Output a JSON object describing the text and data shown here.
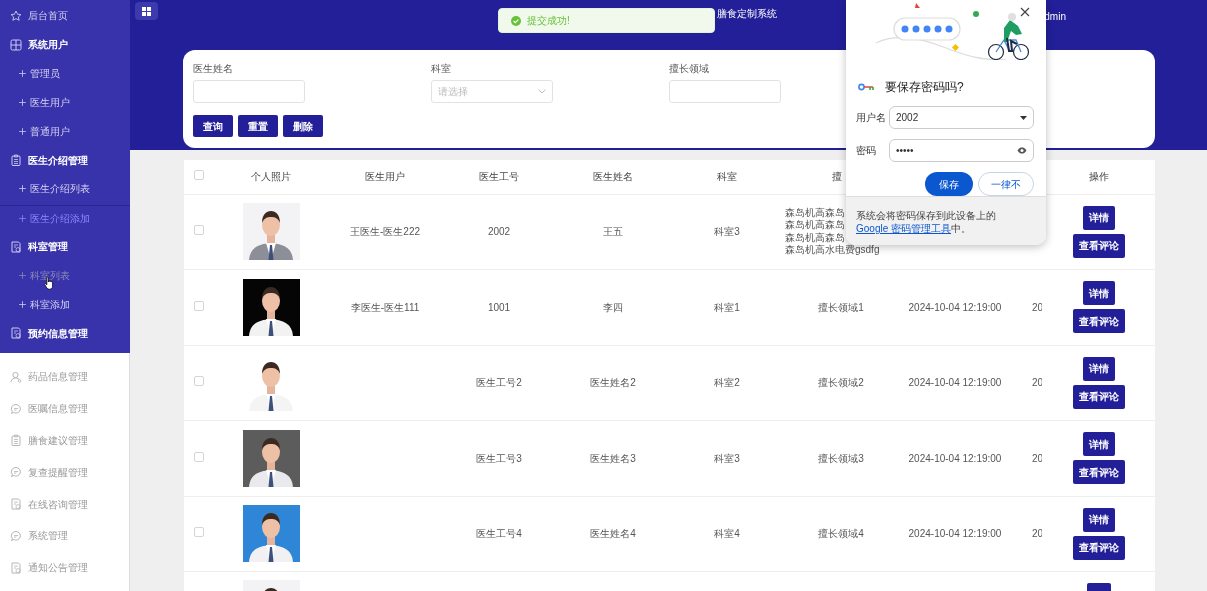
{
  "sidebar": {
    "sections": [
      {
        "items": [
          {
            "label": "后台首页",
            "kind": "link"
          },
          {
            "label": "系统用户",
            "kind": "group",
            "expanded": true,
            "children": [
              {
                "label": "管理员",
                "selected": false,
                "hovered": false
              },
              {
                "label": "医生用户",
                "selected": false,
                "hovered": false
              },
              {
                "label": "普通用户",
                "selected": false,
                "hovered": false
              }
            ]
          },
          {
            "label": "医生介绍管理",
            "kind": "group",
            "expanded": true,
            "children": [
              {
                "label": "医生介绍列表",
                "selected": false,
                "hovered": false
              },
              {
                "label": "医生介绍添加",
                "selected": true,
                "hovered": false
              }
            ]
          },
          {
            "label": "科室管理",
            "kind": "group",
            "expanded": true,
            "children": [
              {
                "label": "科室列表",
                "selected": false,
                "hovered": true
              },
              {
                "label": "科室添加",
                "selected": false,
                "hovered": false
              }
            ]
          },
          {
            "label": "预约信息管理",
            "kind": "group"
          }
        ]
      },
      {
        "items": [
          {
            "label": "药品信息管理",
            "kind": "group"
          },
          {
            "label": "医嘱信息管理",
            "kind": "group"
          },
          {
            "label": "膳食建议管理",
            "kind": "group"
          },
          {
            "label": "复查提醒管理",
            "kind": "group"
          },
          {
            "label": "在线咨询管理",
            "kind": "group"
          },
          {
            "label": "系统管理",
            "kind": "group"
          },
          {
            "label": "通知公告管理",
            "kind": "group"
          }
        ]
      }
    ]
  },
  "header": {
    "title": "膳食定制系统",
    "user": "dmin"
  },
  "toast": {
    "message": "提交成功!"
  },
  "search": {
    "fields": [
      {
        "label": "医生姓名",
        "kind": "text"
      },
      {
        "label": "科室",
        "kind": "select",
        "placeholder": "请选择"
      },
      {
        "label": "擅长领域",
        "kind": "text"
      }
    ],
    "buttons": [
      "查询",
      "重置",
      "删除"
    ]
  },
  "table": {
    "select_all": {
      "checked": false
    },
    "columns": [
      "个人照片",
      "医生用户",
      "医生工号",
      "医生姓名",
      "科室",
      "擅"
    ],
    "action_column": "操作",
    "rows": [
      {
        "kind": "full",
        "checked": false,
        "cells": [
          "王医生-医生222",
          "2002",
          "王五",
          "科室3",
          [
            "森岛机高森岛",
            "森岛机高森岛",
            "森岛机高森岛",
            "森岛机高水电费gsdfg"
          ],
          null,
          null
        ],
        "actions": [
          "详情",
          "查看评论"
        ]
      },
      {
        "kind": "full",
        "checked": false,
        "cells": [
          "李医生-医生111",
          "1001",
          "李四",
          "科室1",
          "擅长领域1",
          "2024-10-04 12:19:00",
          "20"
        ],
        "actions": [
          "详情",
          "查看评论"
        ]
      },
      {
        "kind": "full",
        "checked": false,
        "cells": [
          null,
          "医生工号2",
          "医生姓名2",
          "科室2",
          "擅长领域2",
          "2024-10-04 12:19:00",
          "20"
        ],
        "actions": [
          "详情",
          "查看评论"
        ]
      },
      {
        "kind": "full",
        "checked": false,
        "cells": [
          null,
          "医生工号3",
          "医生姓名3",
          "科室3",
          "擅长领域3",
          "2024-10-04 12:19:00",
          "20"
        ],
        "actions": [
          "详情",
          "查看评论"
        ]
      },
      {
        "kind": "full",
        "checked": false,
        "cells": [
          null,
          "医生工号4",
          "医生姓名4",
          "科室4",
          "擅长领域4",
          "2024-10-04 12:19:00",
          "20"
        ],
        "actions": [
          "详情",
          "查看评论"
        ]
      },
      {
        "kind": "clipped"
      }
    ]
  },
  "password_prompt": {
    "title": "要保存密码吗?",
    "username_label": "用户名",
    "username": "2002",
    "password_label": "密码",
    "password": "•••••",
    "save": "保存",
    "never": "一律不",
    "footer": "系统会将密码保存到此设备上的 ",
    "footer_link": "Google 密码管理工具",
    "footer_end": "中。"
  }
}
